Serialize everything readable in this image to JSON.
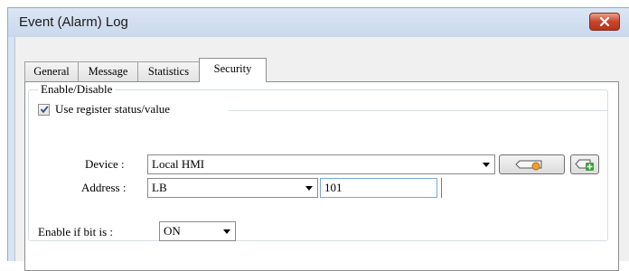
{
  "window": {
    "title": "Event (Alarm) Log"
  },
  "tabs": [
    {
      "label": "General",
      "active": false
    },
    {
      "label": "Message",
      "active": false
    },
    {
      "label": "Statistics",
      "active": false
    },
    {
      "label": "Security",
      "active": true
    }
  ],
  "security": {
    "group_label": "Enable/Disable",
    "use_register": {
      "label": "Use register status/value",
      "checked": true
    },
    "device": {
      "label": "Device :",
      "value": "Local HMI"
    },
    "address": {
      "label": "Address :",
      "type_value": "LB",
      "number_value": "101"
    },
    "enable_if": {
      "label": "Enable if bit is :",
      "value": "ON"
    }
  },
  "icons": {
    "close": "close-icon",
    "device_settings": "tag-settings-icon",
    "device_add": "tag-add-icon"
  },
  "colors": {
    "accent_orange": "#f0a030",
    "accent_green": "#3aa03a",
    "close_red": "#c9442a"
  }
}
